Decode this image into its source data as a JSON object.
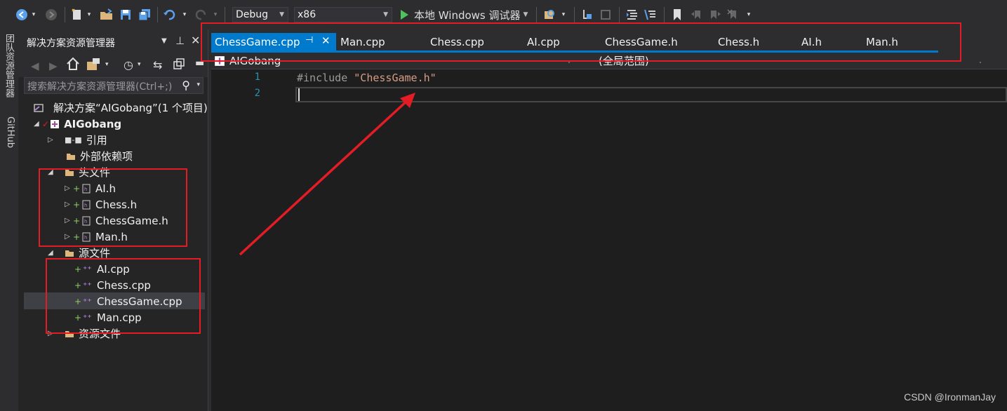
{
  "toolbar": {
    "config": "Debug",
    "platform": "x86",
    "run_label": "本地 Windows 调试器",
    "colors": {
      "run_green": "#4ec35b",
      "save_blue": "#5aa0ea"
    }
  },
  "left_strip": {
    "tabs": [
      "团队资源管理器",
      "GitHub"
    ]
  },
  "solution_explorer": {
    "title": "解决方案资源管理器",
    "search_placeholder": "搜索解决方案资源管理器(Ctrl+;)",
    "solution_label": "解决方案“AIGobang”(1 个项目)",
    "project": "AIGobang",
    "references": "引用",
    "external_deps": "外部依赖项",
    "header_folder": "头文件",
    "headers": [
      "AI.h",
      "Chess.h",
      "ChessGame.h",
      "Man.h"
    ],
    "source_folder": "源文件",
    "sources": [
      "AI.cpp",
      "Chess.cpp",
      "ChessGame.cpp",
      "Man.cpp"
    ],
    "resource_folder": "资源文件",
    "selected": "ChessGame.cpp"
  },
  "tabs": [
    "ChessGame.cpp",
    "Man.cpp",
    "Chess.cpp",
    "AI.cpp",
    "ChessGame.h",
    "Chess.h",
    "AI.h",
    "Man.h"
  ],
  "active_tab": "ChessGame.cpp",
  "navbar": {
    "project": "AIGobang",
    "scope": "(全局范围)"
  },
  "editor": {
    "line_numbers": [
      "1",
      "2"
    ],
    "directive": "#include",
    "include_string": "\"ChessGame.h\"",
    "colors": {
      "directive": "#9b9b9b",
      "string": "#d69d85",
      "line_number": "#2b91af"
    }
  },
  "annotation_color": "#e31c25",
  "watermark": "CSDN @IronmanJay"
}
